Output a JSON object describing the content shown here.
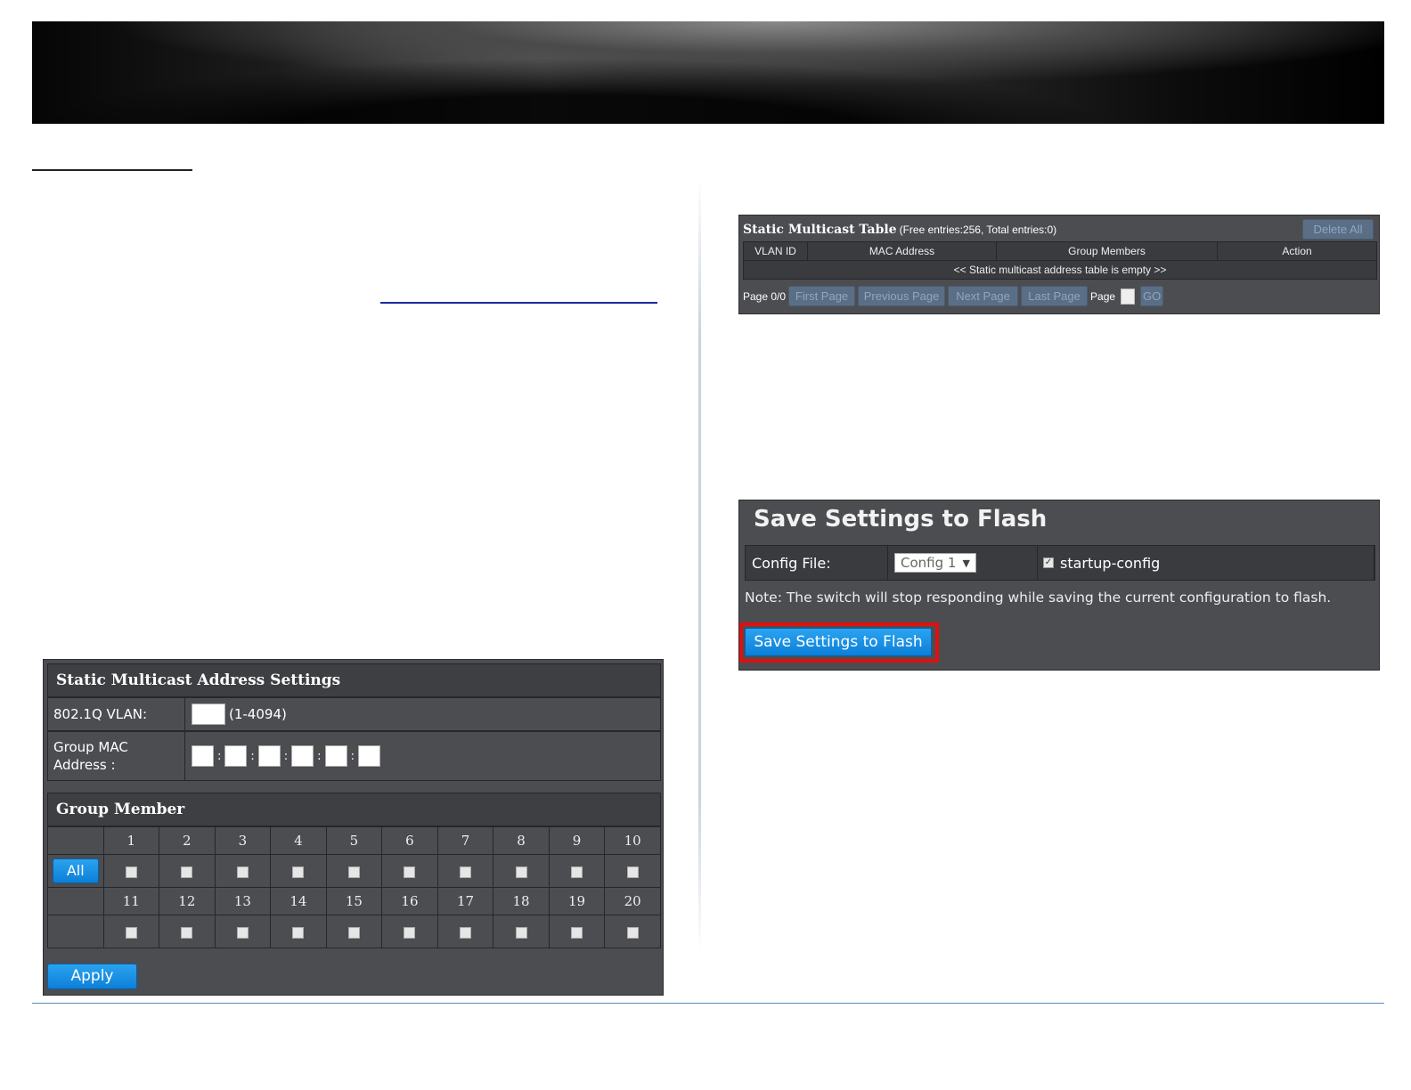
{
  "static_table": {
    "title": "Static Multicast Table",
    "meta": "(Free entries:256, Total entries:0)",
    "delete_all": "Delete All",
    "columns": [
      "VLAN ID",
      "MAC Address",
      "Group Members",
      "Action"
    ],
    "empty_message": "<< Static multicast address table is empty >>",
    "pager": {
      "page_info": "Page 0/0",
      "first": "First Page",
      "previous": "Previous Page",
      "next": "Next Page",
      "last": "Last Page",
      "page_label": "Page",
      "go": "GO"
    }
  },
  "save_flash": {
    "title": "Save Settings to Flash",
    "config_label": "Config File:",
    "config_value": "Config 1",
    "startup_label": "startup-config",
    "startup_checked": true,
    "note": "Note: The switch will stop responding while saving the current configuration to flash.",
    "button": "Save Settings to Flash"
  },
  "address_settings": {
    "title": "Static Multicast Address Settings",
    "vlan_label": "802.1Q VLAN:",
    "vlan_value": "",
    "vlan_range": "(1-4094)",
    "mac_label": "Group MAC Address :",
    "mac_sep": ":",
    "group_title": "Group Member",
    "all_button": "All",
    "ports_row1": [
      "1",
      "2",
      "3",
      "4",
      "5",
      "6",
      "7",
      "8",
      "9",
      "10"
    ],
    "ports_row2": [
      "11",
      "12",
      "13",
      "14",
      "15",
      "16",
      "17",
      "18",
      "19",
      "20"
    ],
    "apply_button": "Apply"
  },
  "colors": {
    "panel_bg": "#4c4d51",
    "cell_bg": "#3a3b3e",
    "button_blue": "#0d7fd8",
    "highlight_red": "#e01010",
    "footer_rule": "#5b8bc4"
  }
}
